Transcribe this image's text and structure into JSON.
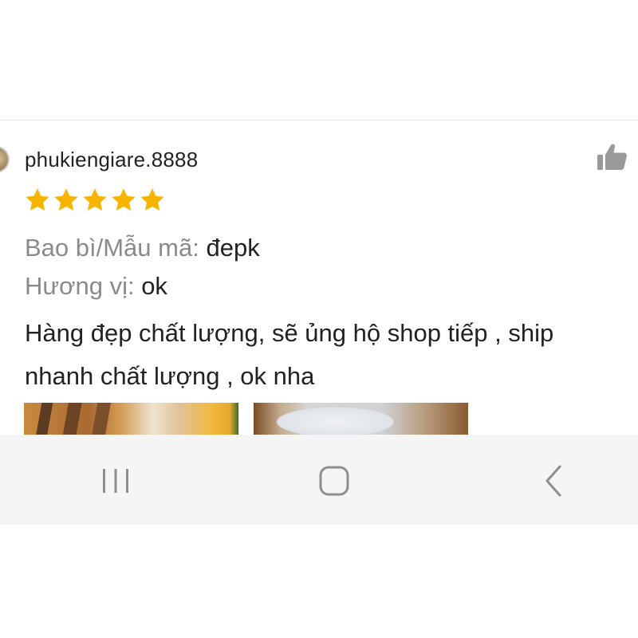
{
  "review": {
    "username": "phukiengiare.8888",
    "rating": 5,
    "rating_max": 5,
    "attributes": [
      {
        "label": "Bao bì/Mẫu mã:",
        "value": "đepk"
      },
      {
        "label": "Hương vị:",
        "value": "ok"
      }
    ],
    "comment_lines": [
      "Hàng đẹp chất lượng, sẽ ủng hộ shop tiếp , ship",
      "nhanh chất lượng , ok nha"
    ],
    "photos": [
      "review-photo-1",
      "review-photo-2"
    ],
    "like_icon": "thumbs-up-icon"
  },
  "navbar": {
    "buttons": [
      "recents-icon",
      "home-icon",
      "back-icon"
    ]
  },
  "colors": {
    "star": "#f8b400",
    "label_gray": "#8a8a8a",
    "text": "#222222",
    "navbar_bg": "#f5f5f5",
    "icon_gray": "#8e8e8e"
  }
}
